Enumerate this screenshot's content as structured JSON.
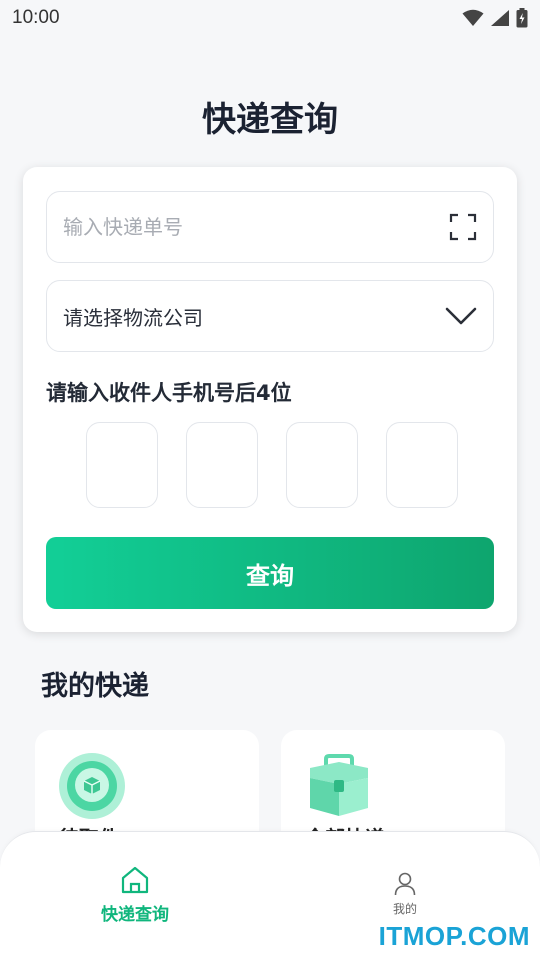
{
  "status_bar": {
    "time": "10:00",
    "icons": [
      "wifi-icon",
      "signal-icon",
      "battery-icon"
    ]
  },
  "page": {
    "title": "快递查询"
  },
  "query_form": {
    "tracking_placeholder": "输入快递单号",
    "tracking_value": "",
    "scan_icon": "scan-icon",
    "company_select_value": "请选择物流公司",
    "company_dropdown_icon": "chevron-down-icon",
    "phone_label": "请输入收件人手机号后4位",
    "phone_digits": [
      "",
      "",
      "",
      ""
    ],
    "submit_label": "查询",
    "accent_gradient": [
      "#12cf97",
      "#0ea56e"
    ]
  },
  "my_parcels": {
    "title": "我的快递",
    "cards": [
      {
        "label": "待取件",
        "icon": "magnifier-box-icon"
      },
      {
        "label": "全部快递",
        "icon": "toolbox-icon"
      }
    ]
  },
  "bottom_nav": {
    "items": [
      {
        "label": "快递查询",
        "icon": "home-icon",
        "active": true
      },
      {
        "label": "我的",
        "icon": "user-icon",
        "active": false
      }
    ],
    "active_color": "#10b67d"
  },
  "watermark": "ITMOP.COM"
}
